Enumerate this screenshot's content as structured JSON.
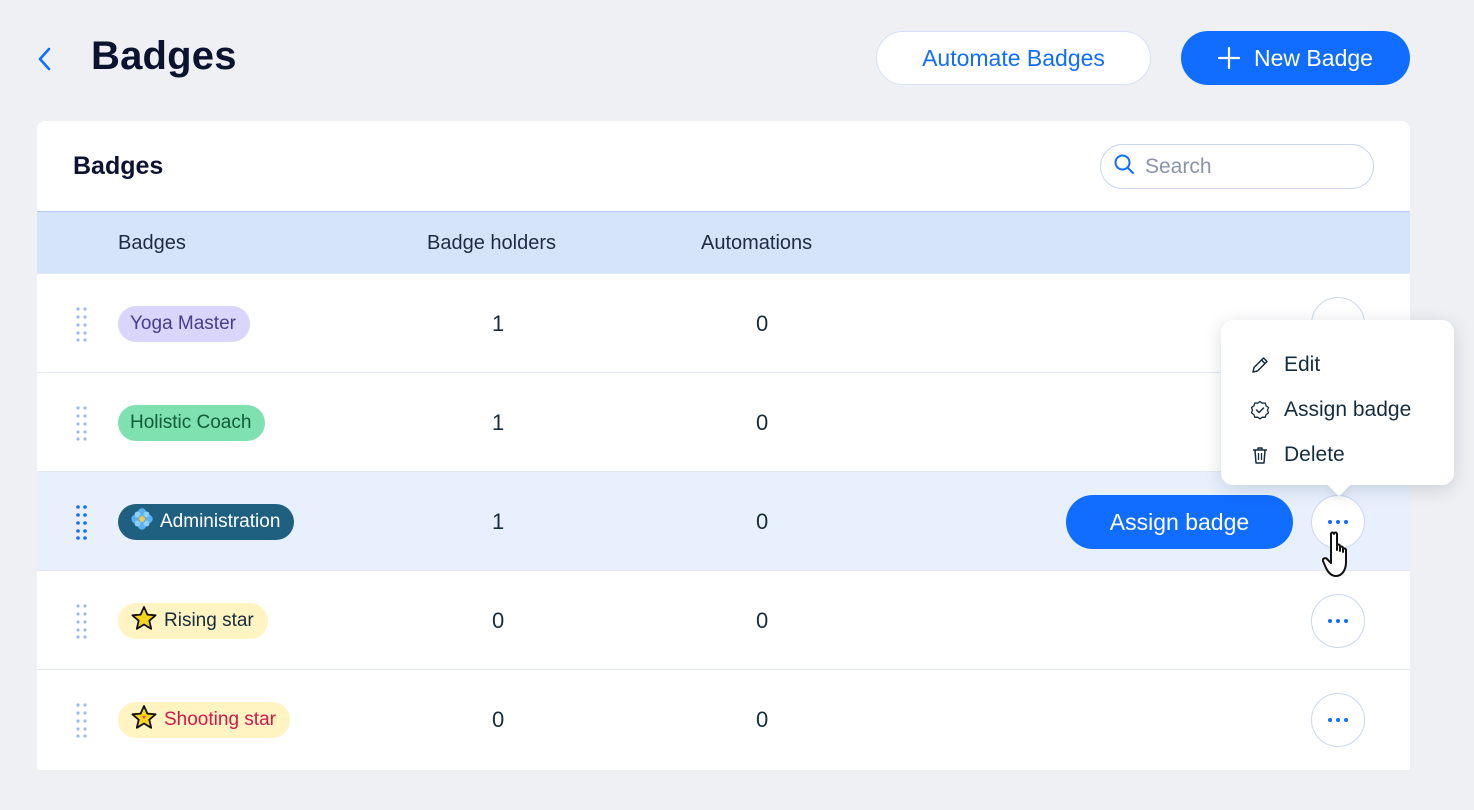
{
  "header": {
    "title": "Badges",
    "automate_label": "Automate Badges",
    "new_label": "New Badge"
  },
  "card": {
    "title": "Badges",
    "search_placeholder": "Search"
  },
  "table": {
    "columns": [
      "Badges",
      "Badge holders",
      "Automations"
    ],
    "rows": [
      {
        "name": "Yoga Master",
        "holders": "1",
        "automations": "0",
        "bg": "#d9d5fb",
        "fg": "#4a3c8c",
        "icon": ""
      },
      {
        "name": "Holistic Coach",
        "holders": "1",
        "automations": "0",
        "bg": "#7fe0b0",
        "fg": "#115c3a",
        "icon": ""
      },
      {
        "name": "Administration",
        "holders": "1",
        "automations": "0",
        "bg": "#1f5f7f",
        "fg": "#ffffff",
        "icon": "flower-icon"
      },
      {
        "name": "Rising star",
        "holders": "0",
        "automations": "0",
        "bg": "#fff4c2",
        "fg": "#162d3d",
        "icon": "star-icon"
      },
      {
        "name": "Shooting star",
        "holders": "0",
        "automations": "0",
        "bg": "#fff4c2",
        "fg": "#d2184a",
        "icon": "shooting-star-icon"
      }
    ]
  },
  "row_action": {
    "assign_label": "Assign badge"
  },
  "menu": {
    "items": [
      {
        "label": "Edit",
        "icon": "pencil-icon"
      },
      {
        "label": "Assign badge",
        "icon": "badge-check-icon"
      },
      {
        "label": "Delete",
        "icon": "trash-icon"
      }
    ]
  },
  "colors": {
    "accent": "#116dff",
    "header_row": "#d6e4fb",
    "hover_row": "#e8f0fe",
    "background": "#eef0f4"
  }
}
